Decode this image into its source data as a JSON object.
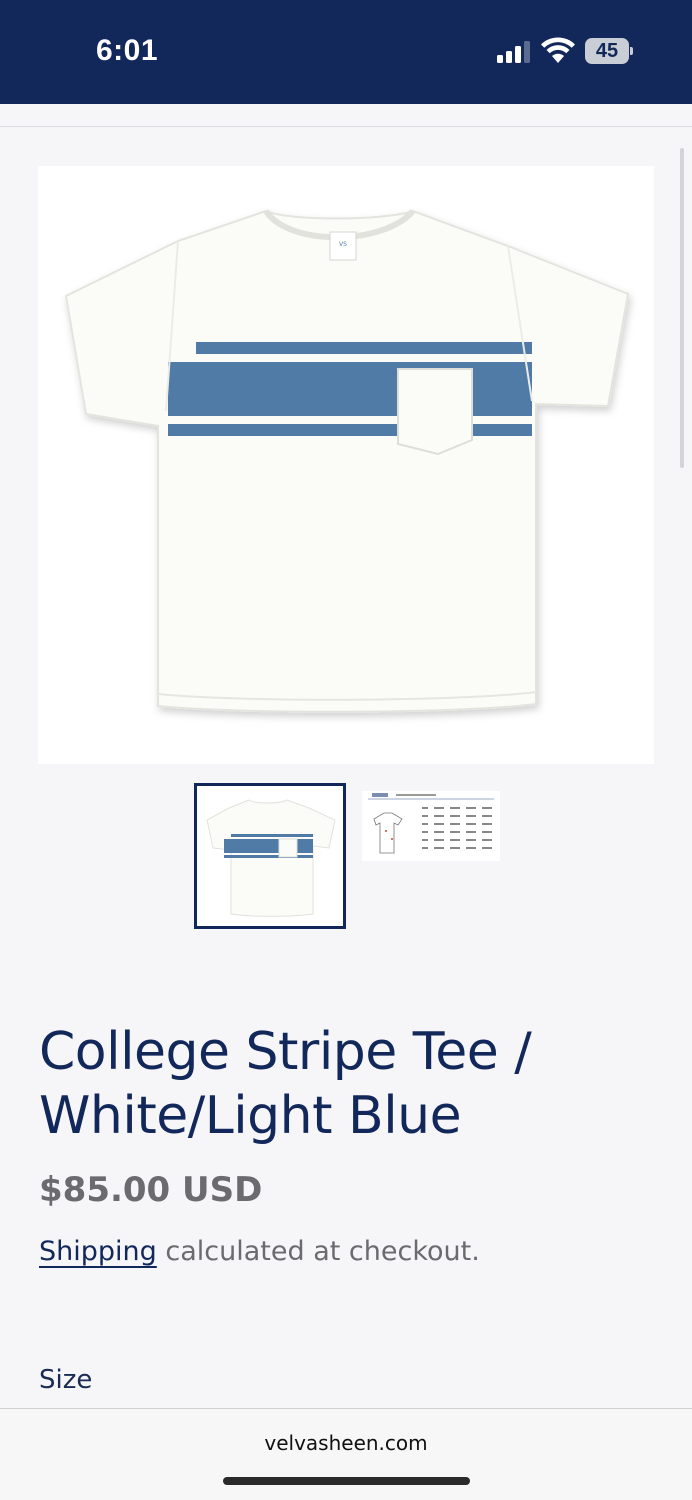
{
  "status": {
    "time": "6:01",
    "battery": "45",
    "icons": [
      "signal-icon",
      "wifi-icon",
      "battery-icon"
    ]
  },
  "product": {
    "title_line1": "College Stripe Tee /",
    "title_line2": "White/Light Blue",
    "price": "$85.00 USD",
    "shipping_link": "Shipping",
    "shipping_rest": " calculated at checkout.",
    "size_label": "Size"
  },
  "gallery": {
    "thumbnails": [
      "tee-front",
      "size-chart"
    ],
    "selected": 0
  },
  "browser": {
    "url": "velvasheen.com"
  },
  "colors": {
    "navy": "#12275a",
    "stripe": "#4f7ba6",
    "price_gray": "#6a6a6f"
  }
}
